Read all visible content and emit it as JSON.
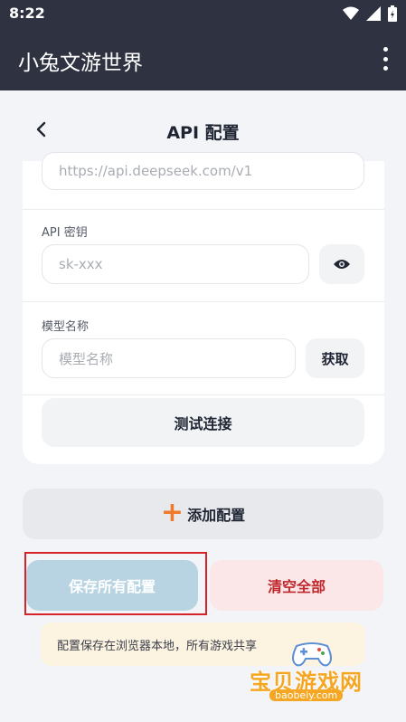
{
  "status_bar": {
    "time": "8:22"
  },
  "app_bar": {
    "title": "小兔文游世界"
  },
  "page": {
    "title": "API 配置"
  },
  "form": {
    "base_url": {
      "placeholder": "https://api.deepseek.com/v1"
    },
    "api_key": {
      "label": "API 密钥",
      "placeholder": "sk-xxx"
    },
    "model": {
      "label": "模型名称",
      "placeholder": "模型名称",
      "fetch_label": "获取"
    },
    "test_label": "测试连接"
  },
  "actions": {
    "add_label": "添加配置",
    "save_label": "保存所有配置",
    "clear_label": "清空全部"
  },
  "notice": "配置保存在浏览器本地，所有游戏共享",
  "watermark": {
    "text": "宝贝游戏网",
    "url": "baobeiy.com"
  },
  "colors": {
    "app_bar": "#2f3240",
    "save_button": "#b8d4e3",
    "clear_button_text": "#c0282e",
    "plus_icon": "#f07a2c",
    "notice_bg": "#fdf3e1",
    "highlight_frame": "#d6232a"
  }
}
